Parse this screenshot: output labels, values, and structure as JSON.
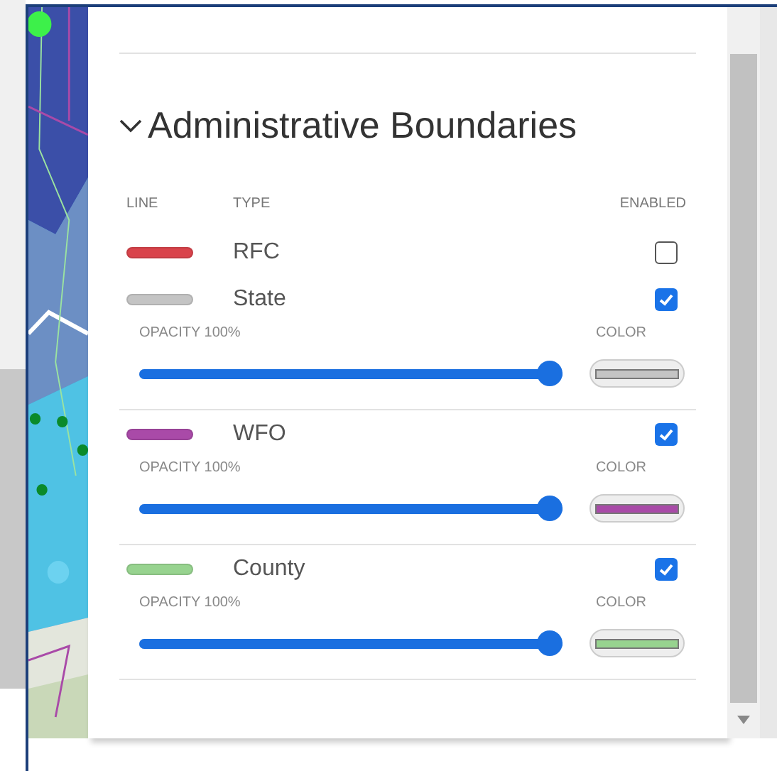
{
  "section": {
    "title": "Administrative Boundaries",
    "expanded": true
  },
  "columns": [
    "LINE",
    "TYPE",
    "ENABLED"
  ],
  "boundaries": [
    {
      "type": "RFC",
      "color": "#d9434b",
      "enabled": false
    },
    {
      "type": "State",
      "color": "#c4c4c4",
      "enabled": true,
      "opacity_label": "OPACITY 100%",
      "level": 1,
      "color_label": "COLOR"
    },
    {
      "type": "WFO",
      "color": "#a94aa8",
      "enabled": true,
      "opacity_label": "OPACITY 100%",
      "level": 1,
      "color_label": "COLOR"
    },
    {
      "type": "County",
      "color": "#97d38f",
      "enabled": true,
      "opacity_label": "OPACITY 100%",
      "level": 1,
      "color_label": "COLOR"
    }
  ]
}
